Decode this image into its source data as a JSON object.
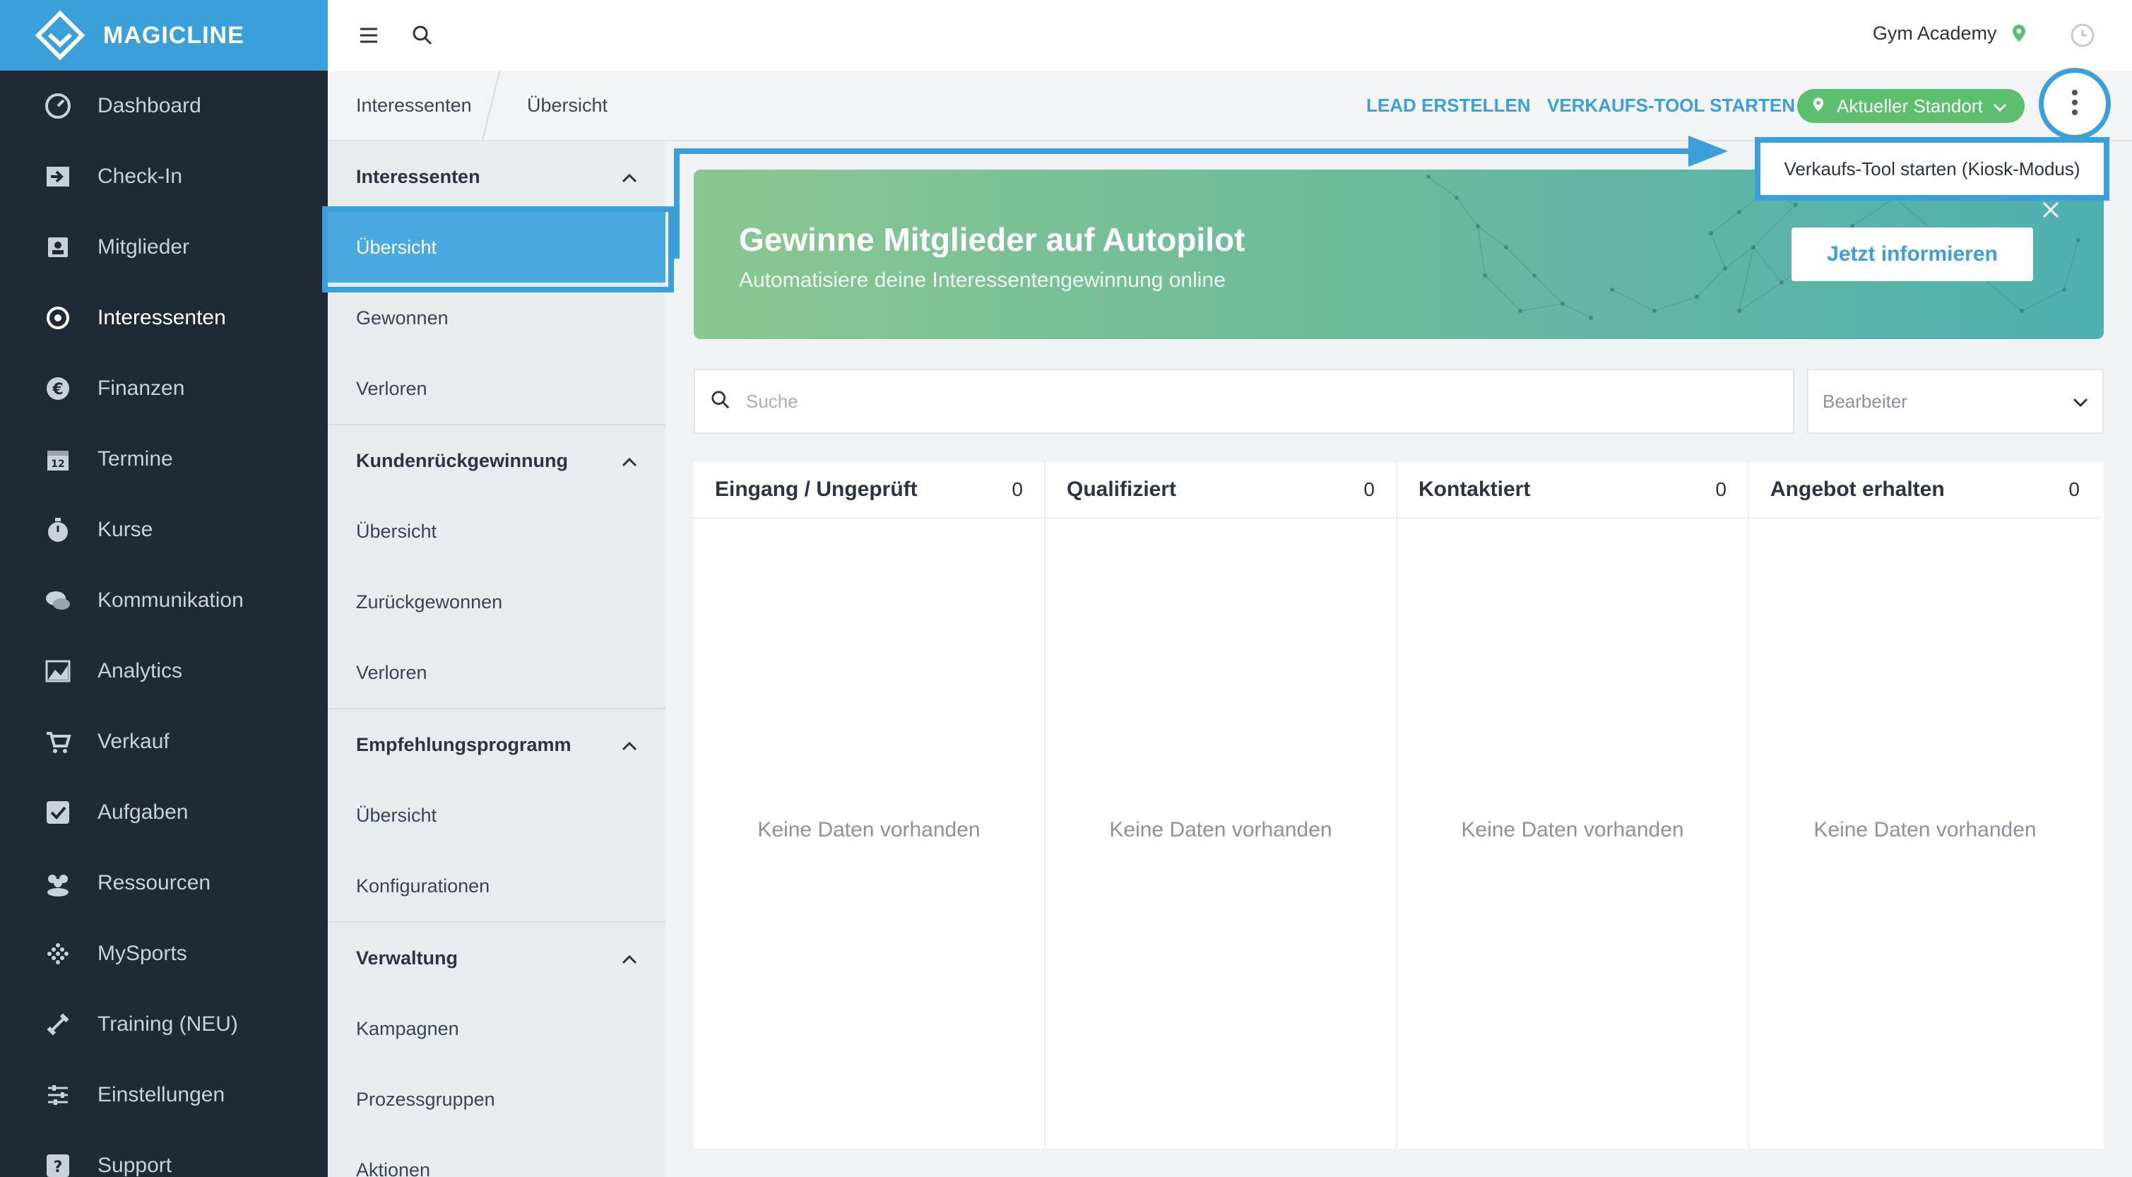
{
  "brand": {
    "name": "MAGICLINE"
  },
  "nav": {
    "items": [
      {
        "label": "Dashboard",
        "icon": "dashboard-icon",
        "active": false
      },
      {
        "label": "Check-In",
        "icon": "check-in-icon",
        "active": false
      },
      {
        "label": "Mitglieder",
        "icon": "members-icon",
        "active": false
      },
      {
        "label": "Interessenten",
        "icon": "target-icon",
        "active": true
      },
      {
        "label": "Finanzen",
        "icon": "euro-icon",
        "active": false
      },
      {
        "label": "Termine",
        "icon": "calendar-icon",
        "active": false
      },
      {
        "label": "Kurse",
        "icon": "stopwatch-icon",
        "active": false
      },
      {
        "label": "Kommunikation",
        "icon": "chat-icon",
        "active": false
      },
      {
        "label": "Analytics",
        "icon": "chart-icon",
        "active": false
      },
      {
        "label": "Verkauf",
        "icon": "cart-icon",
        "active": false
      },
      {
        "label": "Aufgaben",
        "icon": "checkbox-icon",
        "active": false
      },
      {
        "label": "Ressourcen",
        "icon": "group-icon",
        "active": false
      },
      {
        "label": "MySports",
        "icon": "dots-grid-icon",
        "active": false
      },
      {
        "label": "Training (NEU)",
        "icon": "dumbbell-icon",
        "active": false
      },
      {
        "label": "Einstellungen",
        "icon": "sliders-icon",
        "active": false
      },
      {
        "label": "Support",
        "icon": "help-icon",
        "active": false
      }
    ]
  },
  "topbar": {
    "studio": "Gym Academy"
  },
  "subbar": {
    "breadcrumb": [
      "Interessenten",
      "Übersicht"
    ],
    "lead_button": "LEAD ERSTELLEN",
    "sales_tool_button": "VERKAUFS-TOOL STARTEN",
    "location_pill": "Aktueller Standort"
  },
  "dropdown": {
    "item": "Verkaufs-Tool starten (Kiosk-Modus)"
  },
  "subnav": {
    "sections": [
      {
        "title": "Interessenten",
        "items": [
          "Übersicht",
          "Gewonnen",
          "Verloren"
        ]
      },
      {
        "title": "Kundenrückgewinnung",
        "items": [
          "Übersicht",
          "Zurückgewonnen",
          "Verloren"
        ]
      },
      {
        "title": "Empfehlungsprogramm",
        "items": [
          "Übersicht",
          "Konfigurationen"
        ]
      },
      {
        "title": "Verwaltung",
        "items": [
          "Kampagnen",
          "Prozessgruppen",
          "Aktionen"
        ]
      }
    ]
  },
  "banner": {
    "title": "Gewinne Mitglieder auf Autopilot",
    "subtitle": "Automatisiere deine Interessentengewinnung online",
    "cta": "Jetzt informieren"
  },
  "filters": {
    "search_placeholder": "Suche",
    "assignee_placeholder": "Bearbeiter"
  },
  "board": {
    "columns": [
      {
        "title": "Eingang / Ungeprüft",
        "count": "0",
        "empty": "Keine Daten vorhanden"
      },
      {
        "title": "Qualifiziert",
        "count": "0",
        "empty": "Keine Daten vorhanden"
      },
      {
        "title": "Kontaktiert",
        "count": "0",
        "empty": "Keine Daten vorhanden"
      },
      {
        "title": "Angebot erhalten",
        "count": "0",
        "empty": "Keine Daten vorhanden"
      }
    ]
  },
  "colors": {
    "accent": "#3ba0da",
    "nav_bg": "#1f2a36",
    "location_green": "#5cbf6e"
  }
}
